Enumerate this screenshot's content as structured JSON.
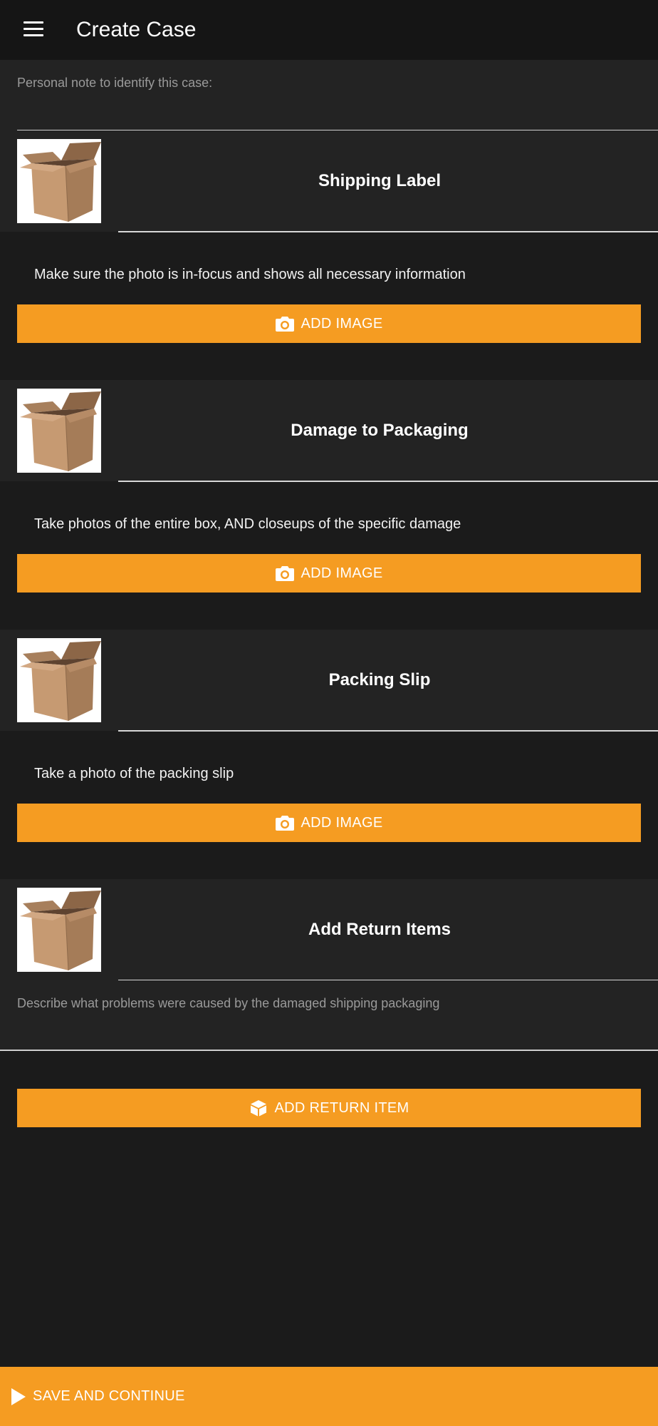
{
  "appbar": {
    "title": "Create Case",
    "menu_icon": "menu-icon"
  },
  "note": {
    "label": "Personal note to identify this case:",
    "value": ""
  },
  "sections": [
    {
      "title": "Shipping Label",
      "instruction": "Make sure the photo is in-focus and shows all necessary information",
      "button_label": "ADD IMAGE",
      "button_icon": "camera-icon"
    },
    {
      "title": "Damage to Packaging",
      "instruction": "Take photos of the entire box, AND closeups of the specific damage",
      "button_label": "ADD IMAGE",
      "button_icon": "camera-icon"
    },
    {
      "title": "Packing Slip",
      "instruction": "Take a photo of the packing slip",
      "button_label": "ADD IMAGE",
      "button_icon": "camera-icon"
    }
  ],
  "return_items": {
    "title": "Add Return Items",
    "description_label": "Describe what problems were caused by the damaged shipping packaging",
    "description_value": "",
    "button_label": "ADD RETURN ITEM",
    "button_icon": "box-icon"
  },
  "footer": {
    "save_label": "SAVE AND CONTINUE",
    "icon": "play-icon"
  },
  "colors": {
    "accent": "#f59c22",
    "background": "#1b1b1b",
    "surface": "#232323",
    "appbar": "#151515"
  }
}
